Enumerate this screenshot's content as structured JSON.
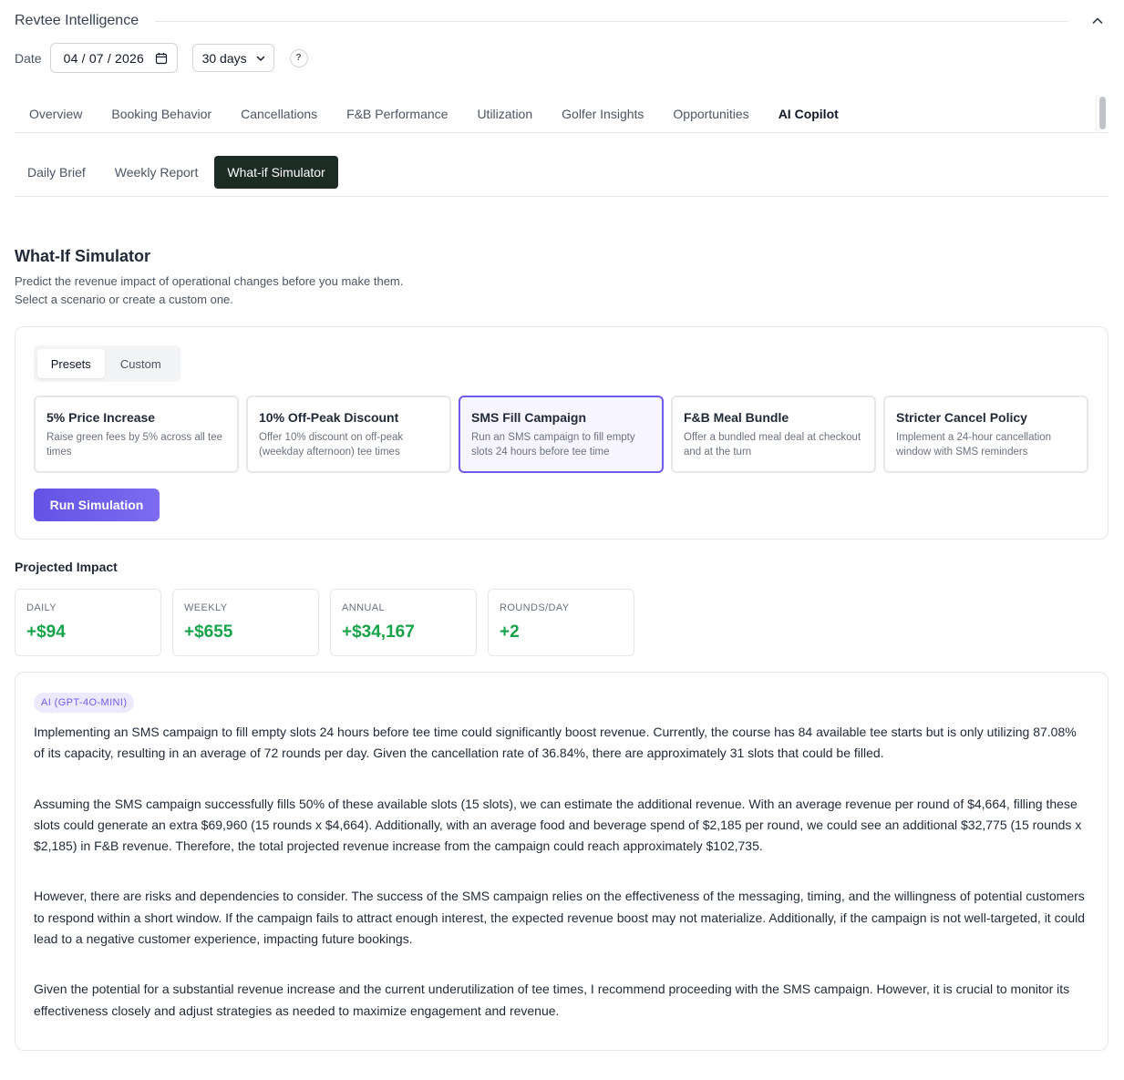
{
  "header": {
    "title": "Revtee Intelligence"
  },
  "filters": {
    "date_label": "Date",
    "date_value": "04 / 07 / 2026",
    "range_value": "30 days",
    "help_label": "?"
  },
  "main_tabs": [
    {
      "label": "Overview"
    },
    {
      "label": "Booking Behavior"
    },
    {
      "label": "Cancellations"
    },
    {
      "label": "F&B Performance"
    },
    {
      "label": "Utilization"
    },
    {
      "label": "Golfer Insights"
    },
    {
      "label": "Opportunities"
    },
    {
      "label": "AI Copilot",
      "active": true
    }
  ],
  "sub_tabs": [
    {
      "label": "Daily Brief"
    },
    {
      "label": "Weekly Report"
    },
    {
      "label": "What-if Simulator",
      "active": true
    }
  ],
  "simulator": {
    "title": "What-If Simulator",
    "description_line1": "Predict the revenue impact of operational changes before you make them.",
    "description_line2": "Select a scenario or create a custom one.",
    "mode_tabs": {
      "presets": "Presets",
      "custom": "Custom",
      "active": "Presets"
    },
    "presets": [
      {
        "title": "5% Price Increase",
        "desc": "Raise green fees by 5% across all tee times"
      },
      {
        "title": "10% Off-Peak Discount",
        "desc": "Offer 10% discount on off-peak (weekday afternoon) tee times"
      },
      {
        "title": "SMS Fill Campaign",
        "desc": "Run an SMS campaign to fill empty slots 24 hours before tee time",
        "selected": true
      },
      {
        "title": "F&B Meal Bundle",
        "desc": "Offer a bundled meal deal at checkout and at the turn"
      },
      {
        "title": "Stricter Cancel Policy",
        "desc": "Implement a 24-hour cancellation window with SMS reminders"
      }
    ],
    "run_button": "Run Simulation"
  },
  "impact": {
    "title": "Projected Impact",
    "metrics": [
      {
        "label": "DAILY",
        "value": "+$94"
      },
      {
        "label": "WEEKLY",
        "value": "+$655"
      },
      {
        "label": "ANNUAL",
        "value": "+$34,167"
      },
      {
        "label": "ROUNDS/DAY",
        "value": "+2"
      }
    ]
  },
  "ai": {
    "badge": "AI (GPT-4O-MINI)",
    "paragraphs": [
      "Implementing an SMS campaign to fill empty slots 24 hours before tee time could significantly boost revenue. Currently, the course has 84 available tee starts but is only utilizing 87.08% of its capacity, resulting in an average of 72 rounds per day. Given the cancellation rate of 36.84%, there are approximately 31 slots that could be filled.",
      "Assuming the SMS campaign successfully fills 50% of these available slots (15 slots), we can estimate the additional revenue. With an average revenue per round of $4,664, filling these slots could generate an extra $69,960 (15 rounds x $4,664). Additionally, with an average food and beverage spend of $2,185 per round, we could see an additional $32,775 (15 rounds x $2,185) in F&B revenue. Therefore, the total projected revenue increase from the campaign could reach approximately $102,735.",
      "However, there are risks and dependencies to consider. The success of the SMS campaign relies on the effectiveness of the messaging, timing, and the willingness of potential customers to respond within a short window. If the campaign fails to attract enough interest, the expected revenue boost may not materialize. Additionally, if the campaign is not well-targeted, it could lead to a negative customer experience, impacting future bookings.",
      "Given the potential for a substantial revenue increase and the current underutilization of tee times, I recommend proceeding with the SMS campaign. However, it is crucial to monitor its effectiveness closely and adjust strategies as needed to maximize engagement and revenue."
    ]
  },
  "icons": {
    "collapse": "chevron-up-icon",
    "calendar": "calendar-icon",
    "dropdown": "chevron-down-icon",
    "help": "help-icon"
  },
  "colors": {
    "accent": "#6d5ce7",
    "active_subtab_bg": "#1c2b24",
    "positive": "#16a34a"
  }
}
